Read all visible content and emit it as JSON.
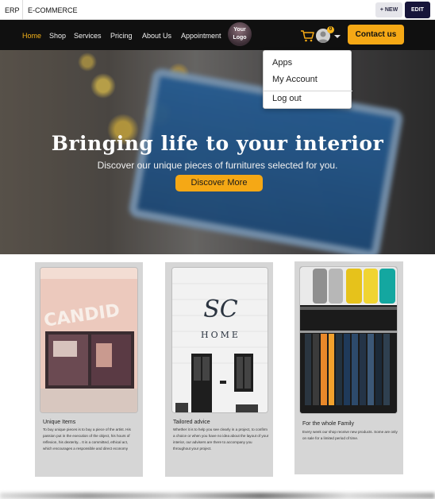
{
  "topbar": {
    "erp": "ERP",
    "ecommerce": "E-COMMERCE",
    "new_label": "+ NEW",
    "edit_label": "EDIT"
  },
  "nav": {
    "items": [
      "Home",
      "Shop",
      "Services",
      "Pricing",
      "About Us",
      "Appointment"
    ],
    "active": "Home"
  },
  "logo": {
    "line1": "Your",
    "line2": "Logo"
  },
  "cart": {
    "count": "0"
  },
  "contact_label": "Contact us",
  "user_menu": {
    "items": [
      "Apps",
      "My Account",
      "Log out"
    ]
  },
  "hero": {
    "title": "Bringing life to your interior",
    "subtitle": "Discover our unique pieces of furnitures selected for you.",
    "cta": "Discover More"
  },
  "cards": [
    {
      "title": "Unique Items",
      "desc": "To buy unique pieces is to buy a piece of the artist. His passion put in the execution of the object, his hours of reflexion, his dexterity... It is a committed, ethical act, which encourages a responsible and direct economy"
    },
    {
      "title": "Tailored advice",
      "desc": "Whether it is to help you see clearly in a project, to confirm a choice or when you have no idea about the layout of your interior, our advisers are there to accompany you throughout your project."
    },
    {
      "title": "For the whole Family",
      "desc": "Every week our shop receive new products. Some are only on sale for a limited period of time."
    }
  ],
  "colors": {
    "accent": "#f5a815",
    "header_bg": "#101010",
    "card_bg": "#d6d6d6"
  }
}
